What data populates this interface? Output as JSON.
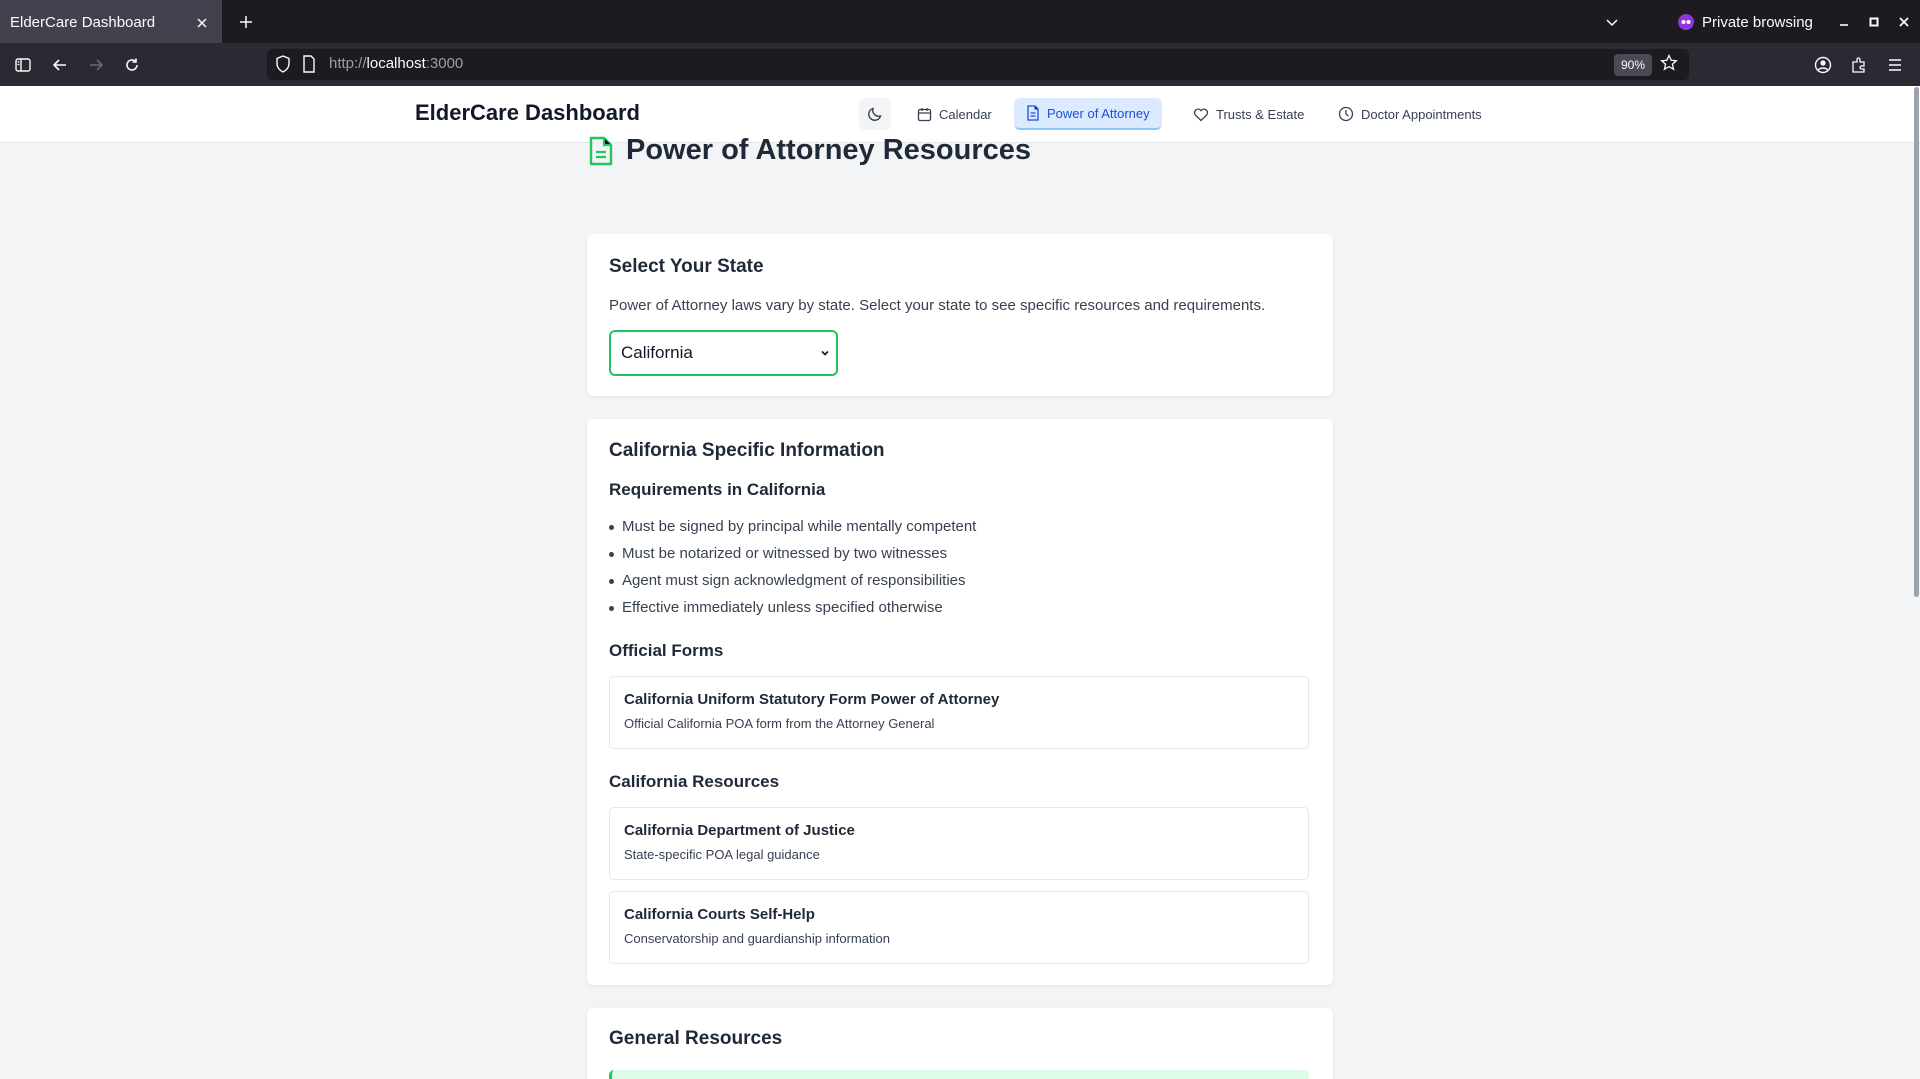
{
  "browser": {
    "tab_title": "ElderCare Dashboard",
    "url_prefix": "http://",
    "url_host": "localhost",
    "url_suffix": ":3000",
    "zoom": "90%",
    "private_label": "Private browsing"
  },
  "app": {
    "brand": "ElderCare Dashboard",
    "nav": [
      {
        "label": "Calendar",
        "icon": "calendar-icon"
      },
      {
        "label": "Power of Attorney",
        "icon": "document-icon",
        "active": true
      },
      {
        "label": "Trusts & Estate",
        "icon": "heart-icon"
      },
      {
        "label": "Doctor Appointments",
        "icon": "clock-icon"
      }
    ],
    "accent_color": "#22c55e",
    "active_nav_color": "#1d4ed8"
  },
  "page": {
    "title": "Power of Attorney Resources",
    "state_card": {
      "heading": "Select Your State",
      "description": "Power of Attorney laws vary by state. Select your state to see specific resources and requirements.",
      "selected_state": "California"
    },
    "specific": {
      "heading": "California Specific Information",
      "requirements_heading": "Requirements in California",
      "requirements": [
        "Must be signed by principal while mentally competent",
        "Must be notarized or witnessed by two witnesses",
        "Agent must sign acknowledgment of responsibilities",
        "Effective immediately unless specified otherwise"
      ],
      "forms_heading": "Official Forms",
      "forms": [
        {
          "title": "California Uniform Statutory Form Power of Attorney",
          "desc": "Official California POA form from the Attorney General"
        }
      ],
      "resources_heading": "California Resources",
      "resources": [
        {
          "title": "California Department of Justice",
          "desc": "State-specific POA legal guidance"
        },
        {
          "title": "California Courts Self-Help",
          "desc": "Conservatorship and guardianship information"
        }
      ]
    },
    "general": {
      "heading": "General Resources"
    }
  }
}
